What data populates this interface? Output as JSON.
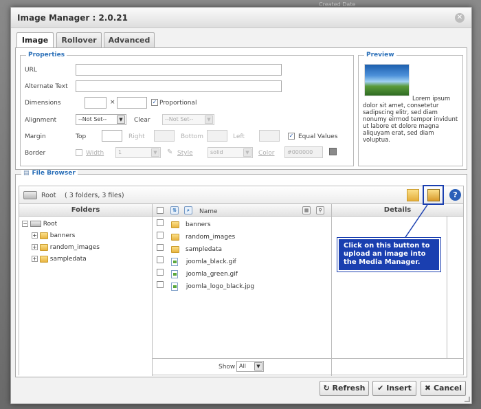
{
  "background": {
    "top_text": "Created Date"
  },
  "dialog": {
    "title": "Image Manager : 2.0.21"
  },
  "tabs": [
    {
      "label": "Image",
      "active": true
    },
    {
      "label": "Rollover",
      "active": false
    },
    {
      "label": "Advanced",
      "active": false
    }
  ],
  "properties": {
    "legend": "Properties",
    "url_label": "URL",
    "alt_label": "Alternate Text",
    "dimensions_label": "Dimensions",
    "dimensions_sep": "×",
    "proportional_label": "Proportional",
    "proportional_checked": true,
    "alignment_label": "Alignment",
    "alignment_value": "--Not Set--",
    "clear_label": "Clear",
    "clear_value": "--Not Set--",
    "margin_label": "Margin",
    "top_label": "Top",
    "right_label": "Right",
    "bottom_label": "Bottom",
    "left_label": "Left",
    "equal_values_label": "Equal Values",
    "equal_values_checked": true,
    "border_label": "Border",
    "width_label": "Width",
    "width_value": "1",
    "style_label": "Style",
    "style_value": "solid",
    "color_label": "Color",
    "color_value": "#000000"
  },
  "preview": {
    "legend": "Preview",
    "text": "Lorem ipsum dolor sit amet, consetetur sadipscing elitr, sed diam nonumy eirmod tempor invidunt ut labore et dolore magna aliquyam erat, sed diam voluptua."
  },
  "file_browser": {
    "legend": "File Browser",
    "path": "Root",
    "summary": "( 3 folders, 3 files)",
    "folders_header": "Folders",
    "name_header": "Name",
    "details_header": "Details",
    "tree": {
      "root": "Root",
      "children": [
        "banners",
        "random_images",
        "sampledata"
      ]
    },
    "items": [
      {
        "name": "banners",
        "type": "folder"
      },
      {
        "name": "random_images",
        "type": "folder"
      },
      {
        "name": "sampledata",
        "type": "folder"
      },
      {
        "name": "joomla_black.gif",
        "type": "file"
      },
      {
        "name": "joomla_green.gif",
        "type": "file"
      },
      {
        "name": "joomla_logo_black.jpg",
        "type": "file"
      }
    ],
    "show_label": "Show",
    "show_value": "All"
  },
  "tooltip": {
    "text": "Click on this button to upload an image into the Media Manager."
  },
  "buttons": {
    "refresh": "Refresh",
    "insert": "Insert",
    "cancel": "Cancel"
  },
  "colors": {
    "accent": "#2a6fb8",
    "tooltip_bg": "#1a3fb0"
  }
}
